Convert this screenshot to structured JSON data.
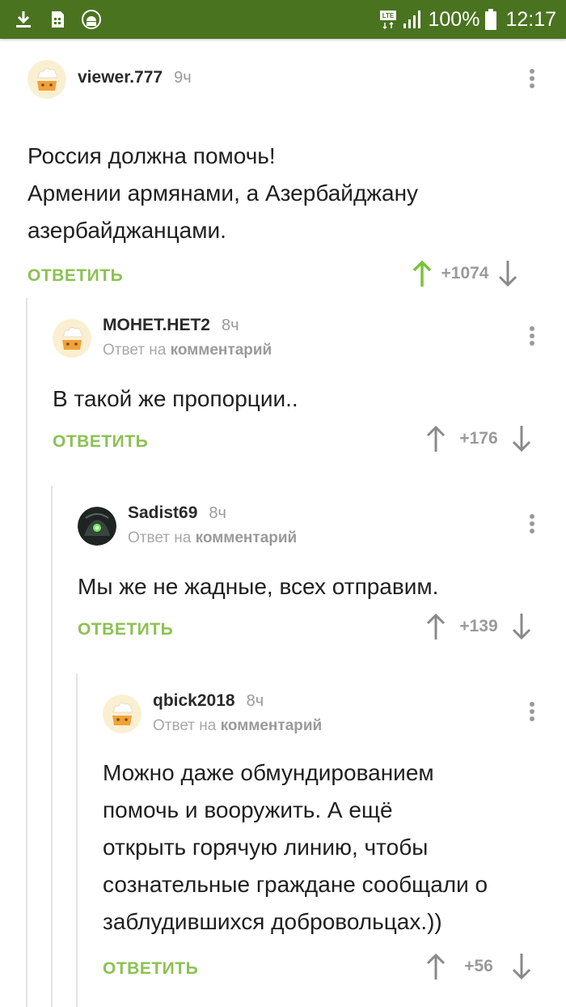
{
  "status_bar": {
    "battery": "100%",
    "time": "12:17",
    "network": "LTE",
    "icons": [
      "download-icon",
      "sim-card-icon",
      "android-icon",
      "lte-icon",
      "signal-icon",
      "battery-icon"
    ],
    "bg_color": "#4a7320"
  },
  "comments": [
    {
      "username": "viewer.777",
      "time": "9ч",
      "reply_to": null,
      "text": "Россия должна помочь!\nАрмении армянами, а Азербайджану\nазербайджанцами.",
      "reply_label": "ОТВЕТИТЬ",
      "score": "+1074",
      "upvoted": true
    },
    {
      "username": "МОНЕТ.НЕТ2",
      "time": "8ч",
      "reply_to": {
        "prefix": "Ответ на",
        "target": "комментарий"
      },
      "text": "В такой же пропорции..",
      "reply_label": "ОТВЕТИТЬ",
      "score": "+176",
      "upvoted": false
    },
    {
      "username": "Sadist69",
      "time": "8ч",
      "reply_to": {
        "prefix": "Ответ на",
        "target": "комментарий"
      },
      "text": "Мы же не жадные, всех отправим.",
      "reply_label": "ОТВЕТИТЬ",
      "score": "+139",
      "upvoted": false
    },
    {
      "username": "qbick2018",
      "time": "8ч",
      "reply_to": {
        "prefix": "Ответ на",
        "target": "комментарий"
      },
      "text": "Можно даже обмундированием\nпомочь и вооружить. А ещё\nоткрыть горячую линию, чтобы\nсознательные граждане сообщали о\nзаблудившихся добровольцах.))",
      "reply_label": "ОТВЕТИТЬ",
      "score": "+56",
      "upvoted": false
    }
  ],
  "colors": {
    "accent_green": "#8cc152",
    "upvote_green": "#7cc23c",
    "muted_gray": "#9a9a9a"
  }
}
